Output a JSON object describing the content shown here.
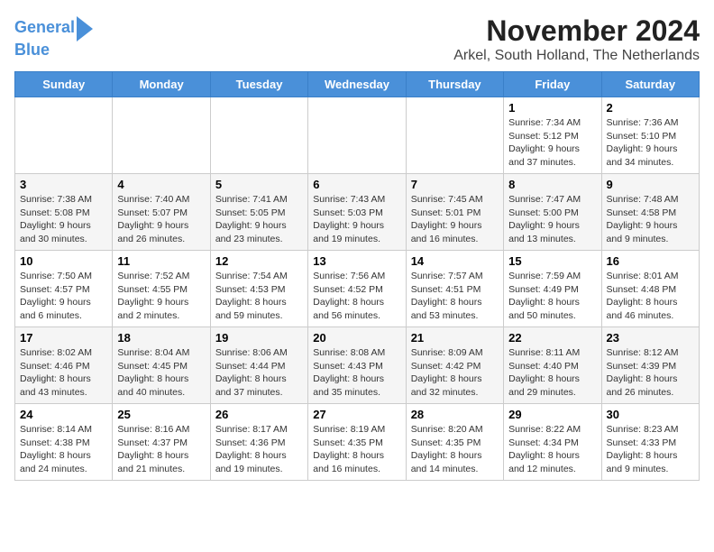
{
  "logo": {
    "line1": "General",
    "line2": "Blue"
  },
  "title": "November 2024",
  "location": "Arkel, South Holland, The Netherlands",
  "weekdays": [
    "Sunday",
    "Monday",
    "Tuesday",
    "Wednesday",
    "Thursday",
    "Friday",
    "Saturday"
  ],
  "weeks": [
    [
      {
        "day": "",
        "info": ""
      },
      {
        "day": "",
        "info": ""
      },
      {
        "day": "",
        "info": ""
      },
      {
        "day": "",
        "info": ""
      },
      {
        "day": "",
        "info": ""
      },
      {
        "day": "1",
        "info": "Sunrise: 7:34 AM\nSunset: 5:12 PM\nDaylight: 9 hours\nand 37 minutes."
      },
      {
        "day": "2",
        "info": "Sunrise: 7:36 AM\nSunset: 5:10 PM\nDaylight: 9 hours\nand 34 minutes."
      }
    ],
    [
      {
        "day": "3",
        "info": "Sunrise: 7:38 AM\nSunset: 5:08 PM\nDaylight: 9 hours\nand 30 minutes."
      },
      {
        "day": "4",
        "info": "Sunrise: 7:40 AM\nSunset: 5:07 PM\nDaylight: 9 hours\nand 26 minutes."
      },
      {
        "day": "5",
        "info": "Sunrise: 7:41 AM\nSunset: 5:05 PM\nDaylight: 9 hours\nand 23 minutes."
      },
      {
        "day": "6",
        "info": "Sunrise: 7:43 AM\nSunset: 5:03 PM\nDaylight: 9 hours\nand 19 minutes."
      },
      {
        "day": "7",
        "info": "Sunrise: 7:45 AM\nSunset: 5:01 PM\nDaylight: 9 hours\nand 16 minutes."
      },
      {
        "day": "8",
        "info": "Sunrise: 7:47 AM\nSunset: 5:00 PM\nDaylight: 9 hours\nand 13 minutes."
      },
      {
        "day": "9",
        "info": "Sunrise: 7:48 AM\nSunset: 4:58 PM\nDaylight: 9 hours\nand 9 minutes."
      }
    ],
    [
      {
        "day": "10",
        "info": "Sunrise: 7:50 AM\nSunset: 4:57 PM\nDaylight: 9 hours\nand 6 minutes."
      },
      {
        "day": "11",
        "info": "Sunrise: 7:52 AM\nSunset: 4:55 PM\nDaylight: 9 hours\nand 2 minutes."
      },
      {
        "day": "12",
        "info": "Sunrise: 7:54 AM\nSunset: 4:53 PM\nDaylight: 8 hours\nand 59 minutes."
      },
      {
        "day": "13",
        "info": "Sunrise: 7:56 AM\nSunset: 4:52 PM\nDaylight: 8 hours\nand 56 minutes."
      },
      {
        "day": "14",
        "info": "Sunrise: 7:57 AM\nSunset: 4:51 PM\nDaylight: 8 hours\nand 53 minutes."
      },
      {
        "day": "15",
        "info": "Sunrise: 7:59 AM\nSunset: 4:49 PM\nDaylight: 8 hours\nand 50 minutes."
      },
      {
        "day": "16",
        "info": "Sunrise: 8:01 AM\nSunset: 4:48 PM\nDaylight: 8 hours\nand 46 minutes."
      }
    ],
    [
      {
        "day": "17",
        "info": "Sunrise: 8:02 AM\nSunset: 4:46 PM\nDaylight: 8 hours\nand 43 minutes."
      },
      {
        "day": "18",
        "info": "Sunrise: 8:04 AM\nSunset: 4:45 PM\nDaylight: 8 hours\nand 40 minutes."
      },
      {
        "day": "19",
        "info": "Sunrise: 8:06 AM\nSunset: 4:44 PM\nDaylight: 8 hours\nand 37 minutes."
      },
      {
        "day": "20",
        "info": "Sunrise: 8:08 AM\nSunset: 4:43 PM\nDaylight: 8 hours\nand 35 minutes."
      },
      {
        "day": "21",
        "info": "Sunrise: 8:09 AM\nSunset: 4:42 PM\nDaylight: 8 hours\nand 32 minutes."
      },
      {
        "day": "22",
        "info": "Sunrise: 8:11 AM\nSunset: 4:40 PM\nDaylight: 8 hours\nand 29 minutes."
      },
      {
        "day": "23",
        "info": "Sunrise: 8:12 AM\nSunset: 4:39 PM\nDaylight: 8 hours\nand 26 minutes."
      }
    ],
    [
      {
        "day": "24",
        "info": "Sunrise: 8:14 AM\nSunset: 4:38 PM\nDaylight: 8 hours\nand 24 minutes."
      },
      {
        "day": "25",
        "info": "Sunrise: 8:16 AM\nSunset: 4:37 PM\nDaylight: 8 hours\nand 21 minutes."
      },
      {
        "day": "26",
        "info": "Sunrise: 8:17 AM\nSunset: 4:36 PM\nDaylight: 8 hours\nand 19 minutes."
      },
      {
        "day": "27",
        "info": "Sunrise: 8:19 AM\nSunset: 4:35 PM\nDaylight: 8 hours\nand 16 minutes."
      },
      {
        "day": "28",
        "info": "Sunrise: 8:20 AM\nSunset: 4:35 PM\nDaylight: 8 hours\nand 14 minutes."
      },
      {
        "day": "29",
        "info": "Sunrise: 8:22 AM\nSunset: 4:34 PM\nDaylight: 8 hours\nand 12 minutes."
      },
      {
        "day": "30",
        "info": "Sunrise: 8:23 AM\nSunset: 4:33 PM\nDaylight: 8 hours\nand 9 minutes."
      }
    ]
  ]
}
